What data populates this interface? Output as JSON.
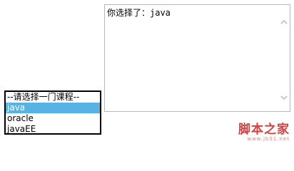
{
  "course_select": {
    "options": [
      {
        "label": "--请选择一门课程--",
        "selected": false
      },
      {
        "label": "java",
        "selected": true
      },
      {
        "label": "oracle",
        "selected": false
      },
      {
        "label": "javaEE",
        "selected": false
      }
    ]
  },
  "output_textarea": {
    "value": "你选择了：java"
  },
  "watermark": {
    "name": "脚本之家",
    "url": "www.jb51.net"
  },
  "colors": {
    "selected_bg": "#56b3e3",
    "watermark": "#d64140"
  }
}
